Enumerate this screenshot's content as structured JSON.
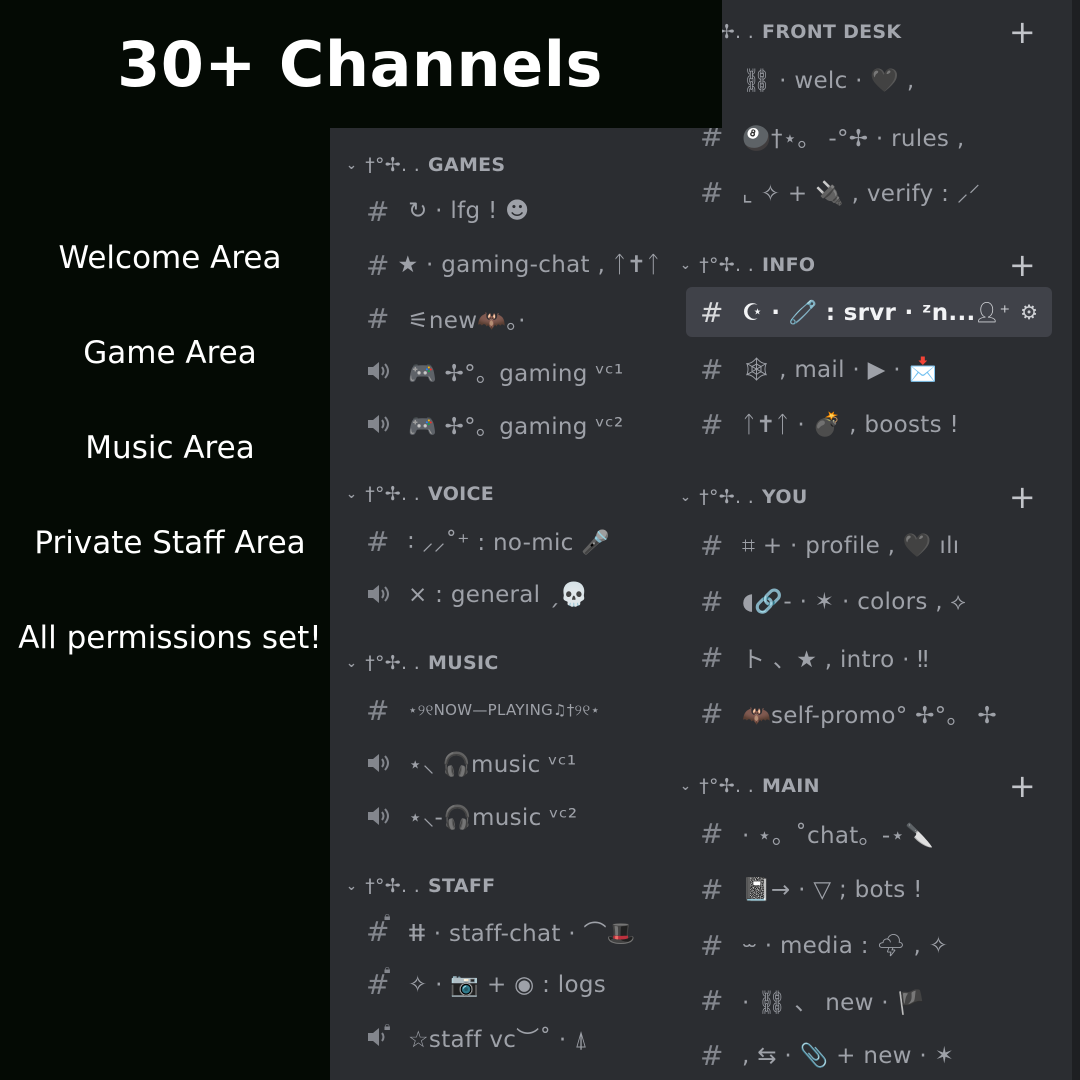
{
  "promo": {
    "headline": "30+ Channels",
    "features": [
      "Welcome Area",
      "Game Area",
      "Music Area",
      "Private Staff Area",
      "All permissions set!"
    ]
  },
  "category_deco": "†°✢. .",
  "left_panel": {
    "categories": [
      {
        "name": "GAMES",
        "channels": [
          {
            "type": "text",
            "name": "↻ · lfg ! ☻"
          },
          {
            "type": "text",
            "name": "★ · gaming-chat ‚ ᛏ✝ᛏ"
          },
          {
            "type": "text",
            "name": "⚟new🦇。·"
          },
          {
            "type": "voice",
            "name": "🎮 ✢°。gaming ᵛᶜ¹"
          },
          {
            "type": "voice",
            "name": "🎮 ✢°。gaming ᵛᶜ²"
          }
        ]
      },
      {
        "name": "VOICE",
        "channels": [
          {
            "type": "text",
            "name": "∶ ⸝⸝˚⁺ : no-mic 🎤"
          },
          {
            "type": "voice",
            "name": "× : general ˏ💀"
          }
        ]
      },
      {
        "name": "MUSIC",
        "channels": [
          {
            "type": "text",
            "name": "⋆୨୧NOW—PLAYING♫†୨୧⋆"
          },
          {
            "type": "voice",
            "name": "⋆⸜ 🎧music ᵛᶜ¹"
          },
          {
            "type": "voice",
            "name": "⋆⸜-🎧music ᵛᶜ²"
          }
        ]
      },
      {
        "name": "STAFF",
        "channels": [
          {
            "type": "private-text",
            "name": "ⵌ · staff-chat · ⌒🎩"
          },
          {
            "type": "private-text",
            "name": "✧ · 📷 + ◉ : logs"
          },
          {
            "type": "private-voice",
            "name": "☆staff vc︶˚ · ⍋"
          }
        ]
      }
    ]
  },
  "right_panel": {
    "categories": [
      {
        "name": "FRONT DESK",
        "channels": [
          {
            "type": "text",
            "name": "⛓ · welc · 🖤 ,"
          },
          {
            "type": "text",
            "name": "🎱†⋆。 -°✢ · rules ,"
          },
          {
            "type": "text",
            "name": "⌞ ✧ + 🔌 , verify : ⸝⸍"
          }
        ]
      },
      {
        "name": "INFO",
        "channels": [
          {
            "type": "text",
            "name": "☪ · 🧷 : srvr · ᶻn...",
            "active": true
          },
          {
            "type": "text",
            "name": "🕸 , mail · ▶ · 📩"
          },
          {
            "type": "text",
            "name": "ᛏ✝ᛏ · 💣 , boosts !"
          }
        ]
      },
      {
        "name": "YOU",
        "channels": [
          {
            "type": "text",
            "name": "⌗ + · profile , 🖤 ılı"
          },
          {
            "type": "text",
            "name": "◖🔗- · ✶ · colors , ⟡"
          },
          {
            "type": "text",
            "name": "ト 、★ , intro · ‼"
          },
          {
            "type": "text",
            "name": "🦇self-promo° ✢°。 ✢"
          }
        ]
      },
      {
        "name": "MAIN",
        "channels": [
          {
            "type": "text",
            "name": "· ⋆。˚chat。-⋆🔪"
          },
          {
            "type": "text",
            "name": "📓→ · ▽ ; bots !"
          },
          {
            "type": "text",
            "name": "⏖ · media : 🌩 , ✧"
          },
          {
            "type": "text",
            "name": "· ⛓ 、 new · 🏴"
          },
          {
            "type": "text",
            "name": ", ⇆ · 📎 + new · ✶"
          }
        ]
      }
    ]
  },
  "icons": {
    "category_chevron": "chevron-down-icon",
    "category_add": "plus-icon",
    "text_channel": "hash-icon",
    "voice_channel": "speaker-icon",
    "private_marker": "lock-icon",
    "invite": "add-member-icon",
    "settings": "gear-icon"
  },
  "colors": {
    "page_bg": "#040a04",
    "sidebar_bg": "#2b2d31",
    "active_channel_bg": "#404249",
    "category_text": "#a3a6ad",
    "channel_text": "#9ea1a8",
    "promo_text": "#ffffff"
  }
}
